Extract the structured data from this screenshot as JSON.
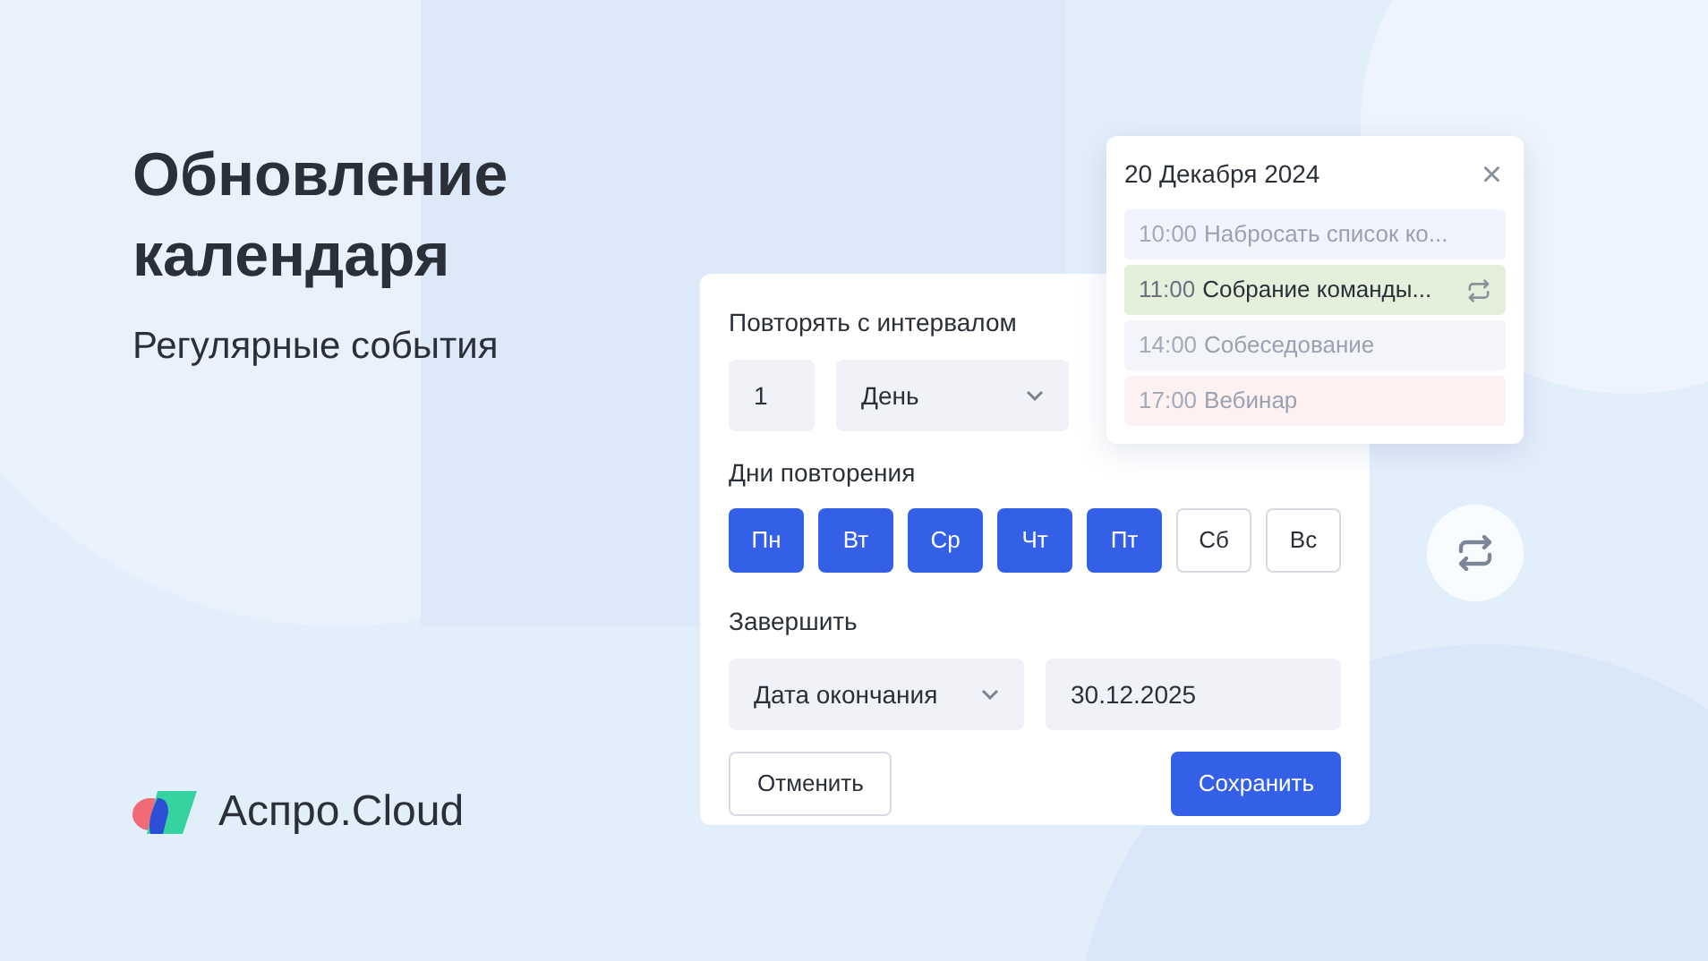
{
  "headline": "Обновление календаря",
  "subtitle": "Регулярные события",
  "brand": "Аспро.Cloud",
  "form": {
    "interval_label": "Повторять с интервалом",
    "interval_value": "1",
    "interval_unit": "День",
    "days_label": "Дни повторения",
    "days": [
      {
        "label": "Пн",
        "selected": true
      },
      {
        "label": "Вт",
        "selected": true
      },
      {
        "label": "Ср",
        "selected": true
      },
      {
        "label": "Чт",
        "selected": true
      },
      {
        "label": "Пт",
        "selected": true
      },
      {
        "label": "Сб",
        "selected": false
      },
      {
        "label": "Вс",
        "selected": false
      }
    ],
    "end_label": "Завершить",
    "end_mode": "Дата окончания",
    "end_date": "30.12.2025",
    "buttons": [
      {
        "label": "Отменить",
        "kind": "secondary"
      },
      {
        "label": "Сохранить",
        "kind": "primary"
      }
    ]
  },
  "popup": {
    "title": "20 Декабря 2024",
    "close": "×",
    "events": [
      {
        "time": "10:00",
        "title": "Набросать список ко...",
        "color": "#f1f4fc",
        "faded": true,
        "recurring": false
      },
      {
        "time": "11:00",
        "title": "Собрание команды...",
        "color": "#e5f0dc",
        "faded": false,
        "recurring": true
      },
      {
        "time": "14:00",
        "title": "Собеседование",
        "color": "#f3f5fb",
        "faded": true,
        "recurring": false
      },
      {
        "time": "17:00",
        "title": "Вебинар",
        "color": "#fdf1f1",
        "faded": true,
        "recurring": false
      }
    ]
  }
}
